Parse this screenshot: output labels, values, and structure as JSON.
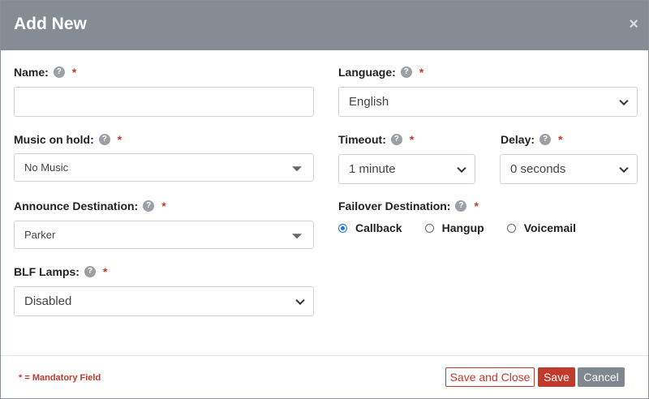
{
  "modal": {
    "title": "Add New",
    "close_glyph": "×"
  },
  "form": {
    "name": {
      "label": "Name:",
      "value": "",
      "placeholder": ""
    },
    "language": {
      "label": "Language:",
      "value": "English"
    },
    "music_on_hold": {
      "label": "Music on hold:",
      "value": "No Music"
    },
    "timeout": {
      "label": "Timeout:",
      "value": "1 minute"
    },
    "delay": {
      "label": "Delay:",
      "value": "0 seconds"
    },
    "announce_destination": {
      "label": "Announce Destination:",
      "value": "Parker"
    },
    "failover_destination": {
      "label": "Failover Destination:",
      "options": [
        "Callback",
        "Hangup",
        "Voicemail"
      ],
      "selected": "Callback"
    },
    "blf_lamps": {
      "label": "BLF Lamps:",
      "value": "Disabled"
    },
    "help_glyph": "?",
    "required_marker": "*"
  },
  "footer": {
    "mandatory_note": "* = Mandatory Field",
    "save_close_label": "Save and Close",
    "save_label": "Save",
    "cancel_label": "Cancel"
  },
  "colors": {
    "header_bg": "#858c94",
    "accent_red": "#c0392b",
    "radio_blue": "#1a73e8",
    "cancel_gray": "#7f8790"
  },
  "icons": [
    "help-icon",
    "close-icon",
    "chevron-down-icon",
    "caret-down-icon",
    "radio-icon"
  ]
}
